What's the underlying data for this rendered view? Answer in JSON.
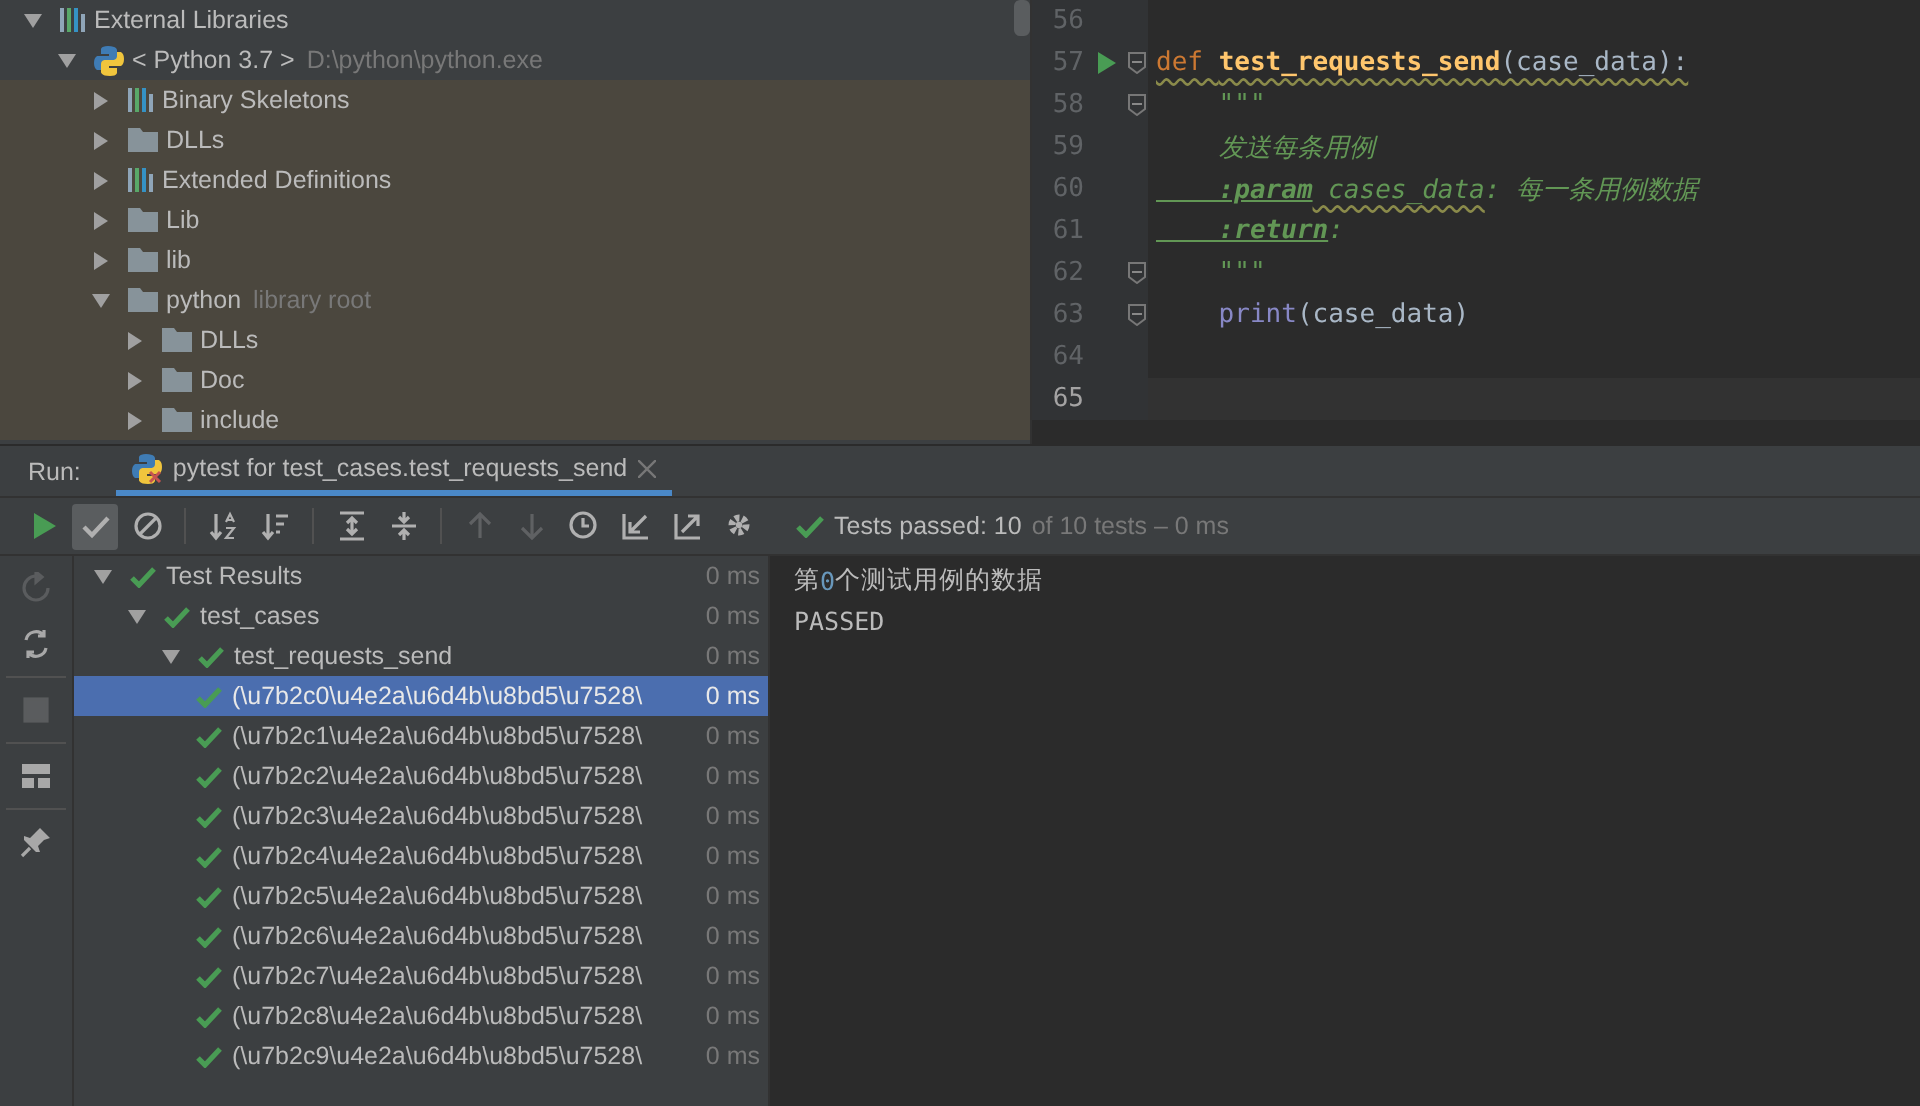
{
  "project_tree": [
    {
      "label": "External Libraries",
      "kind": "library",
      "expanded": true,
      "children": [
        {
          "label": "< Python 3.7 >",
          "hint": "D:\\python\\python.exe",
          "kind": "python",
          "expanded": true,
          "children": [
            {
              "label": "Binary Skeletons",
              "kind": "library",
              "expanded": false
            },
            {
              "label": "DLLs",
              "kind": "folder",
              "expanded": false
            },
            {
              "label": "Extended Definitions",
              "kind": "library",
              "expanded": false
            },
            {
              "label": "Lib",
              "kind": "folder",
              "expanded": false
            },
            {
              "label": "lib",
              "kind": "folder",
              "expanded": false
            },
            {
              "label": "python",
              "hint": "library root",
              "kind": "folder",
              "expanded": true,
              "children": [
                {
                  "label": "DLLs",
                  "kind": "folder",
                  "expanded": false
                },
                {
                  "label": "Doc",
                  "kind": "folder",
                  "expanded": false
                },
                {
                  "label": "include",
                  "kind": "folder",
                  "expanded": false
                }
              ]
            }
          ]
        }
      ]
    }
  ],
  "editor": {
    "lines": [
      {
        "number": "56",
        "run": false,
        "fold": false,
        "current": false
      },
      {
        "number": "57",
        "run": true,
        "fold": true,
        "current": false,
        "tokens": [
          {
            "text": "def ",
            "kind": "keyword",
            "squiggle": true
          },
          {
            "text": "test_requests_send",
            "kind": "function",
            "squiggle": true
          },
          {
            "text": "(case_data):",
            "kind": "plain",
            "squiggle": true
          }
        ]
      },
      {
        "number": "58",
        "run": false,
        "fold": true,
        "current": false,
        "tokens": [
          {
            "text": "    \"\"\"",
            "kind": "doc",
            "squiggle": false
          }
        ]
      },
      {
        "number": "59",
        "run": false,
        "fold": false,
        "current": false,
        "tokens": [
          {
            "text": "    发送每条用例",
            "kind": "doc",
            "squiggle": false
          }
        ]
      },
      {
        "number": "60",
        "run": false,
        "fold": false,
        "current": false,
        "tokens": [
          {
            "text": "    :param",
            "kind": "doctag",
            "squiggle": false
          },
          {
            "text": " cases_data",
            "kind": "doc",
            "squiggle": true
          },
          {
            "text": ": 每一条用例数据",
            "kind": "doc",
            "squiggle": false
          }
        ]
      },
      {
        "number": "61",
        "run": false,
        "fold": false,
        "current": false,
        "tokens": [
          {
            "text": "    :return",
            "kind": "doctag",
            "squiggle": false
          },
          {
            "text": ":",
            "kind": "doc",
            "squiggle": false
          }
        ]
      },
      {
        "number": "62",
        "run": false,
        "fold": true,
        "current": false,
        "tokens": [
          {
            "text": "    \"\"\"",
            "kind": "doc",
            "squiggle": false
          }
        ]
      },
      {
        "number": "63",
        "run": false,
        "fold": true,
        "current": false,
        "tokens": [
          {
            "text": "    print",
            "kind": "builtin",
            "squiggle": false
          },
          {
            "text": "(case_data)",
            "kind": "plain",
            "squiggle": false
          }
        ]
      },
      {
        "number": "64",
        "run": false,
        "fold": false,
        "current": false
      },
      {
        "number": "65",
        "run": false,
        "fold": false,
        "current": true
      }
    ]
  },
  "run_panel": {
    "label": "Run:",
    "tabs": [
      {
        "title": "pytest for test_cases.test_requests_send",
        "selected": true
      }
    ],
    "toolbar": [
      {
        "kind": "run",
        "on": false,
        "disabled": false
      },
      {
        "kind": "show-passed",
        "on": true,
        "disabled": false
      },
      {
        "kind": "show-ignored",
        "on": false,
        "disabled": false
      },
      {
        "kind": "separator"
      },
      {
        "kind": "sort-alpha",
        "on": false,
        "disabled": false
      },
      {
        "kind": "sort-duration",
        "on": false,
        "disabled": false
      },
      {
        "kind": "separator"
      },
      {
        "kind": "expand-all",
        "on": false,
        "disabled": false
      },
      {
        "kind": "collapse-all",
        "on": false,
        "disabled": false
      },
      {
        "kind": "separator"
      },
      {
        "kind": "previous",
        "on": false,
        "disabled": true
      },
      {
        "kind": "next",
        "on": false,
        "disabled": true
      },
      {
        "kind": "history",
        "on": false,
        "disabled": false
      },
      {
        "kind": "import",
        "on": false,
        "disabled": false
      },
      {
        "kind": "export",
        "on": false,
        "disabled": false
      },
      {
        "kind": "settings",
        "on": false,
        "disabled": false
      }
    ],
    "summary": {
      "passed": "Tests passed: 10",
      "rest": "of 10 tests – 0 ms"
    },
    "side_tools": [
      {
        "kind": "rerun-failed",
        "disabled": true
      },
      {
        "kind": "auto-test",
        "disabled": false
      },
      {
        "kind": "stop",
        "disabled": true
      },
      {
        "kind": "layout",
        "disabled": false
      },
      {
        "kind": "pin",
        "disabled": false
      }
    ],
    "test_tree": [
      {
        "label": "Test Results",
        "time": "0 ms",
        "kind": "passed",
        "expanded": true,
        "selected": false,
        "children": [
          {
            "label": "test_cases",
            "time": "0 ms",
            "kind": "passed",
            "expanded": true,
            "selected": false,
            "children": [
              {
                "label": "test_requests_send",
                "time": "0 ms",
                "kind": "passed",
                "expanded": true,
                "selected": false,
                "children": [
                  {
                    "label": "(\\u7b2c0\\u4e2a\\u6d4b\\u8bd5\\u7528\\",
                    "time": "0 ms",
                    "kind": "passed",
                    "selected": true
                  },
                  {
                    "label": "(\\u7b2c1\\u4e2a\\u6d4b\\u8bd5\\u7528\\",
                    "time": "0 ms",
                    "kind": "passed",
                    "selected": false
                  },
                  {
                    "label": "(\\u7b2c2\\u4e2a\\u6d4b\\u8bd5\\u7528\\",
                    "time": "0 ms",
                    "kind": "passed",
                    "selected": false
                  },
                  {
                    "label": "(\\u7b2c3\\u4e2a\\u6d4b\\u8bd5\\u7528\\",
                    "time": "0 ms",
                    "kind": "passed",
                    "selected": false
                  },
                  {
                    "label": "(\\u7b2c4\\u4e2a\\u6d4b\\u8bd5\\u7528\\",
                    "time": "0 ms",
                    "kind": "passed",
                    "selected": false
                  },
                  {
                    "label": "(\\u7b2c5\\u4e2a\\u6d4b\\u8bd5\\u7528\\",
                    "time": "0 ms",
                    "kind": "passed",
                    "selected": false
                  },
                  {
                    "label": "(\\u7b2c6\\u4e2a\\u6d4b\\u8bd5\\u7528\\",
                    "time": "0 ms",
                    "kind": "passed",
                    "selected": false
                  },
                  {
                    "label": "(\\u7b2c7\\u4e2a\\u6d4b\\u8bd5\\u7528\\",
                    "time": "0 ms",
                    "kind": "passed",
                    "selected": false
                  },
                  {
                    "label": "(\\u7b2c8\\u4e2a\\u6d4b\\u8bd5\\u7528\\",
                    "time": "0 ms",
                    "kind": "passed",
                    "selected": false
                  },
                  {
                    "label": "(\\u7b2c9\\u4e2a\\u6d4b\\u8bd5\\u7528\\",
                    "time": "0 ms",
                    "kind": "passed",
                    "selected": false
                  }
                ]
              }
            ]
          }
        ]
      }
    ],
    "console": [
      {
        "segments": [
          {
            "text": "第",
            "kind": "plain"
          },
          {
            "text": "0",
            "kind": "number"
          },
          {
            "text": "个测试用例的数据",
            "kind": "plain"
          }
        ]
      },
      {
        "segments": [
          {
            "text": "PASSED",
            "kind": "plain"
          }
        ]
      }
    ]
  }
}
